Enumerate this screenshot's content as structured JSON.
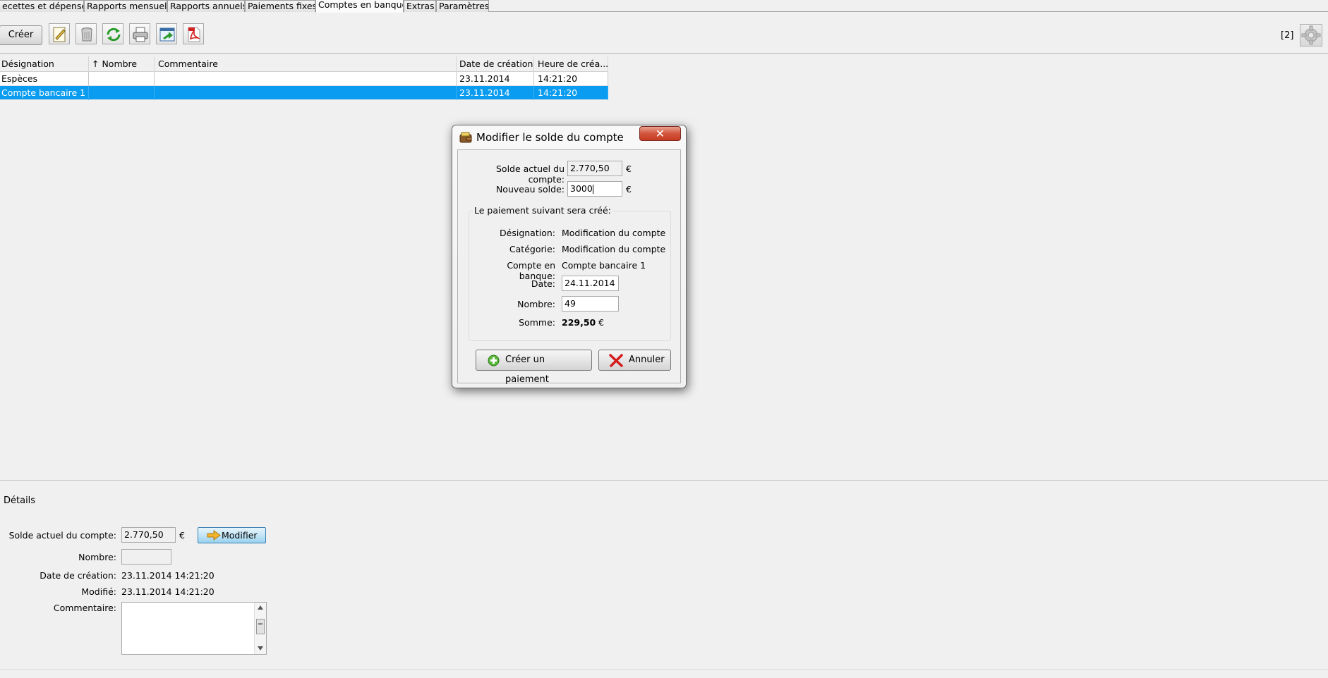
{
  "tabs": [
    {
      "label": "ecettes et dépenses"
    },
    {
      "label": "Rapports mensuels"
    },
    {
      "label": "Rapports annuels"
    },
    {
      "label": "Paiements fixes"
    },
    {
      "label": "Comptes en banque"
    },
    {
      "label": "Extras"
    },
    {
      "label": "Paramètres"
    }
  ],
  "toolbar": {
    "create_label": "Créer",
    "counter": "[2]",
    "icons": [
      "edit-icon",
      "delete-icon",
      "refresh-icon",
      "print-icon",
      "export-icon",
      "pdf-icon",
      "gear-icon"
    ]
  },
  "table": {
    "columns": [
      "Désignation",
      "↑ Nombre",
      "Commentaire",
      "Date de création",
      "Heure de créa..."
    ],
    "rows": [
      {
        "designation": "Espèces",
        "nombre": "",
        "commentaire": "",
        "date": "23.11.2014",
        "heure": "14:21:20",
        "selected": false
      },
      {
        "designation": "Compte bancaire 1",
        "nombre": "",
        "commentaire": "",
        "date": "23.11.2014",
        "heure": "14:21:20",
        "selected": true
      }
    ]
  },
  "dialog": {
    "title": "Modifier le solde du compte",
    "close_glyph": "✕",
    "solde_label": "Solde actuel du compte:",
    "solde_value": "2.770,50",
    "nouveau_label": "Nouveau solde:",
    "nouveau_value": "3000",
    "currency": "€",
    "group_title": "Le paiement suivant sera créé:",
    "designation_label": "Désignation:",
    "designation_value": "Modification du compte",
    "categorie_label": "Catégorie:",
    "categorie_value": "Modification du compte",
    "compte_label": "Compte en banque:",
    "compte_value": "Compte bancaire 1",
    "date_label": "Date:",
    "date_value": "24.11.2014",
    "nombre_label": "Nombre:",
    "nombre_value": "49",
    "somme_label": "Somme:",
    "somme_value": "229,50",
    "create_button": "Créer un paiement",
    "cancel_button": "Annuler"
  },
  "details": {
    "title": "Détails",
    "solde_label": "Solde actuel du compte:",
    "solde_value": "2.770,50",
    "currency": "€",
    "modify_button": "Modifier",
    "nombre_label": "Nombre:",
    "nombre_value": "",
    "creation_label": "Date de création:",
    "creation_value": "23.11.2014  14:21:20",
    "modifie_label": "Modifié:",
    "modifie_value": "23.11.2014  14:21:20",
    "comment_label": "Commentaire:",
    "comment_value": ""
  }
}
